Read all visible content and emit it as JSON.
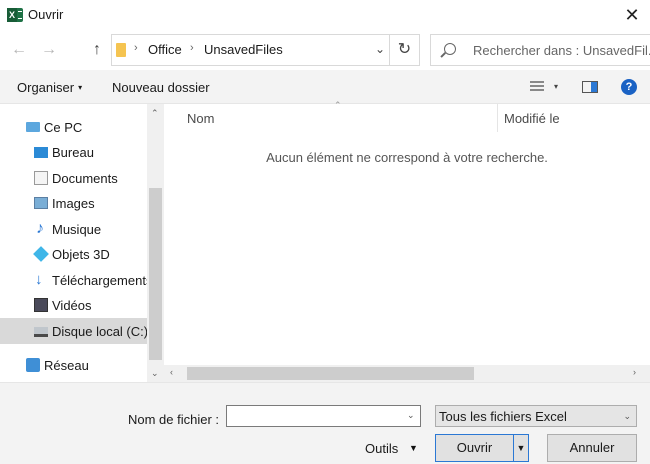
{
  "window": {
    "title": "Ouvrir",
    "app_icon": "excel-icon",
    "close_glyph": "✕"
  },
  "address": {
    "back_glyph": "←",
    "forward_glyph": "→",
    "up_glyph": "↑",
    "refresh_glyph": "↻",
    "dropdown_glyph": "⌄",
    "separator_glyph": "›",
    "breadcrumbs": [
      "Office",
      "UnsavedFiles"
    ],
    "search_placeholder": "Rechercher dans : UnsavedFil..."
  },
  "toolbar": {
    "organize_label": "Organiser",
    "new_folder_label": "Nouveau dossier",
    "caret_glyph": "▾",
    "help_glyph": "?"
  },
  "nav": {
    "items": [
      {
        "label": "Ce PC",
        "icon": "computer-icon"
      },
      {
        "label": "Bureau",
        "icon": "desktop-icon"
      },
      {
        "label": "Documents",
        "icon": "documents-icon"
      },
      {
        "label": "Images",
        "icon": "pictures-icon"
      },
      {
        "label": "Musique",
        "icon": "music-icon"
      },
      {
        "label": "Objets 3D",
        "icon": "3d-objects-icon"
      },
      {
        "label": "Téléchargements",
        "icon": "downloads-icon"
      },
      {
        "label": "Vidéos",
        "icon": "videos-icon"
      },
      {
        "label": "Disque local (C:)",
        "icon": "local-disk-icon",
        "selected": true
      },
      {
        "label": "Réseau",
        "icon": "network-icon"
      }
    ]
  },
  "content": {
    "columns": [
      "Nom",
      "Modifié le"
    ],
    "empty_message": "Aucun élément ne correspond à votre recherche."
  },
  "footer": {
    "filename_label": "Nom de fichier :",
    "filename_value": "",
    "filetype_label": "Tous les fichiers Excel",
    "tools_label": "Outils",
    "open_label": "Ouvrir",
    "cancel_label": "Annuler"
  },
  "colors": {
    "accent": "#2b78d4",
    "excel_green": "#1e7145",
    "selection": "#d9d9d9"
  }
}
